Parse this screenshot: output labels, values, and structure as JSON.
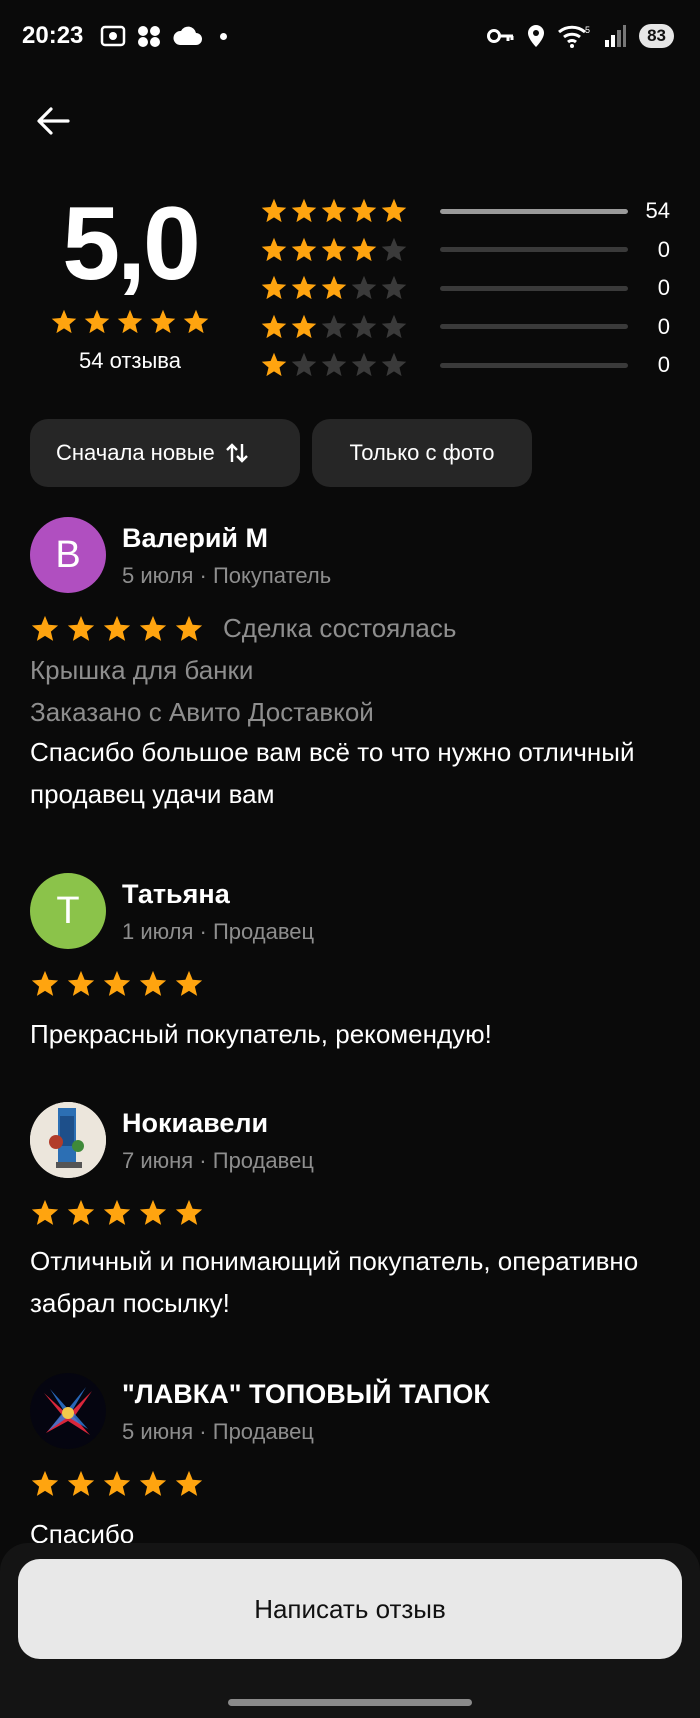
{
  "status_bar": {
    "time": "20:23",
    "battery": "83",
    "icons": [
      "screenshot-icon",
      "apps-icon",
      "cloud-icon",
      "notification-dot",
      "key-icon",
      "location-icon",
      "wifi-icon",
      "signal-icon",
      "battery-icon"
    ]
  },
  "summary": {
    "rating": "5,0",
    "review_count": "54 отзыва",
    "distribution": [
      {
        "stars": 5,
        "count": "54",
        "fraction": 1.0
      },
      {
        "stars": 4,
        "count": "0",
        "fraction": 0
      },
      {
        "stars": 3,
        "count": "0",
        "fraction": 0
      },
      {
        "stars": 2,
        "count": "0",
        "fraction": 0
      },
      {
        "stars": 1,
        "count": "0",
        "fraction": 0
      }
    ]
  },
  "filters": {
    "sort": "Сначала новые",
    "photo_only": "Только с фото"
  },
  "reviews": [
    {
      "avatar_letter": "В",
      "avatar_color": "#b04fc0",
      "author": "Валерий М",
      "meta": "5 июля · Покупатель",
      "stars": 5,
      "deal_status": "Сделка состоялась",
      "item": "Крышка для банки",
      "delivery": "Заказано с Авито Доставкой",
      "text": "Спасибо большое вам всё то что нужно отличный продавец удачи вам"
    },
    {
      "avatar_letter": "Т",
      "avatar_color": "#8bc34a",
      "author": "Татьяна",
      "meta": "1 июля · Продавец",
      "stars": 5,
      "text": "Прекрасный покупатель, рекомендую!"
    },
    {
      "author": "Нокиавели",
      "meta": "7 июня · Продавец",
      "stars": 5,
      "text": "Отличный и понимающий покупатель, оперативно забрал посылку!"
    },
    {
      "author": "\"ЛАВКА\" ТОПОВЫЙ ТАПОК",
      "meta": "5 июня · Продавец",
      "stars": 5,
      "text": "Спасибо"
    }
  ],
  "colors": {
    "star": "#ffa40f",
    "star_empty": "#3a3a3a",
    "background": "#0a0a0a"
  },
  "write_review_label": "Написать отзыв"
}
